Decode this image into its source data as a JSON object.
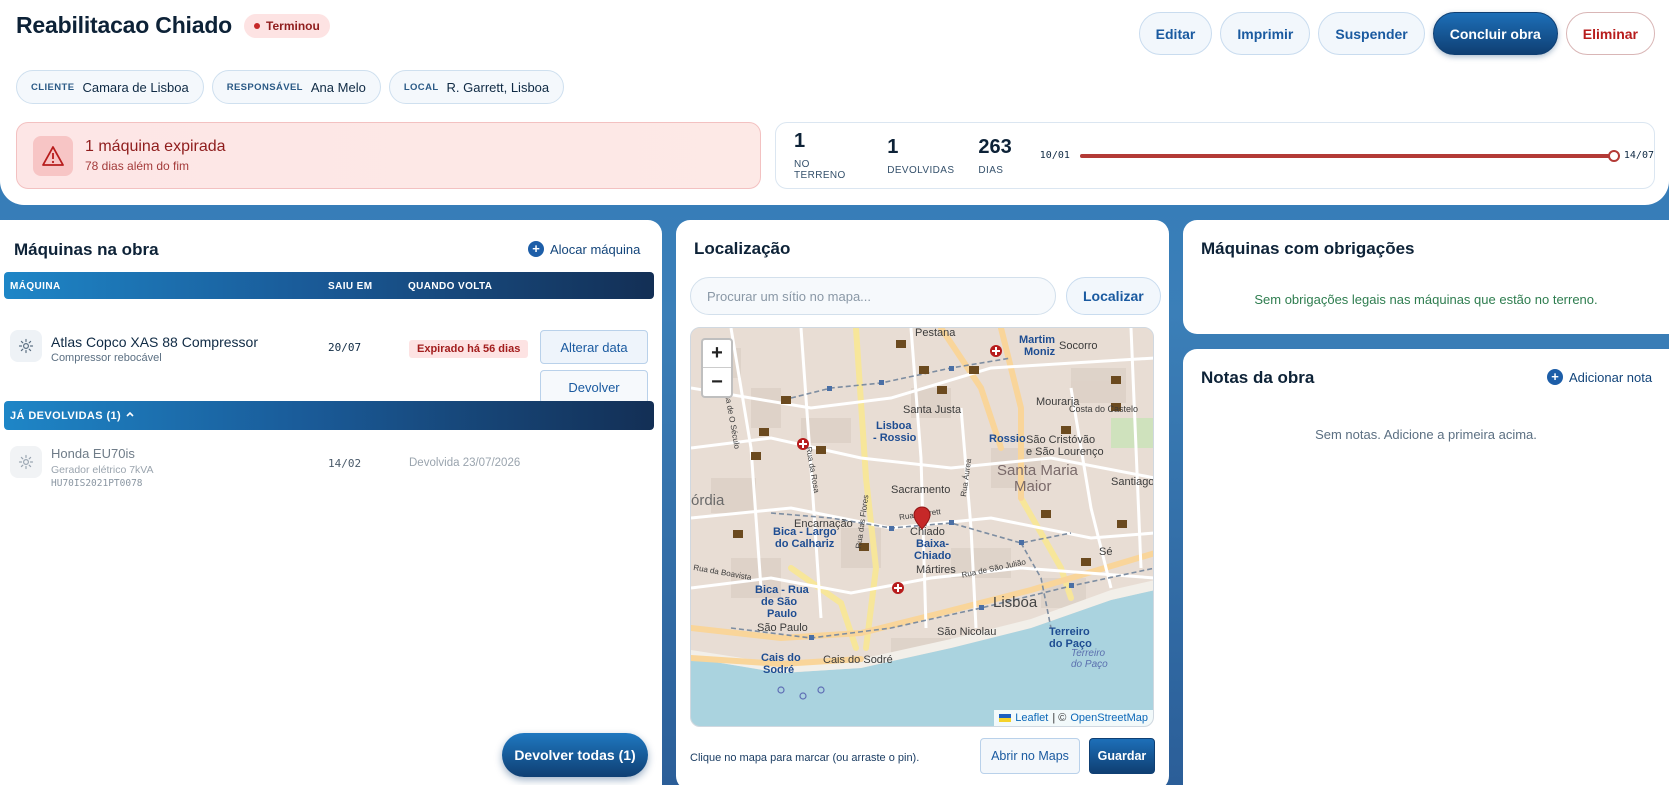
{
  "header": {
    "title": "Reabilitacao Chiado",
    "status": "Terminou",
    "actions": {
      "edit": "Editar",
      "print": "Imprimir",
      "suspend": "Suspender",
      "complete": "Concluir obra",
      "delete": "Eliminar"
    },
    "chips": [
      {
        "key": "CLIENTE",
        "value": "Camara de Lisboa"
      },
      {
        "key": "RESPONSÁVEL",
        "value": "Ana Melo"
      },
      {
        "key": "LOCAL",
        "value": "R. Garrett, Lisboa"
      }
    ]
  },
  "alert": {
    "title": "1 máquina expirada",
    "subtitle": "78 dias além do fim"
  },
  "stats": {
    "items": [
      {
        "value": "1",
        "label": "NO TERRENO"
      },
      {
        "value": "1",
        "label": "DEVOLVIDAS"
      },
      {
        "value": "263",
        "label": "DIAS"
      }
    ],
    "timeline": {
      "start": "10/01",
      "end": "14/07",
      "progress": 1.0
    }
  },
  "machines": {
    "title": "Máquinas na obra",
    "add_label": "Alocar máquina",
    "columns": [
      "MÁQUINA",
      "SAIU EM",
      "QUANDO VOLTA"
    ],
    "active": [
      {
        "name": "Atlas Copco XAS 88 Compressor",
        "type": "Compressor rebocável",
        "left_on": "20/07",
        "status": "Expirado há 56 dias",
        "change_date_label": "Alterar data",
        "return_label": "Devolver"
      }
    ],
    "returned_header": "JÁ DEVOLVIDAS (1)",
    "returned": [
      {
        "name": "Honda EU70is",
        "type": "Gerador elétrico 7kVA",
        "serial": "HU70IS2021PT0078",
        "left_on": "14/02",
        "returned_on": "Devolvida 23/07/2026"
      }
    ],
    "return_all_label": "Devolver todas (1)"
  },
  "location": {
    "title": "Localização",
    "search_placeholder": "Procurar um sítio no mapa...",
    "search_button": "Localizar",
    "hint": "Clique no mapa para marcar (ou arraste o pin).",
    "open_maps": "Abrir no Maps",
    "save": "Guardar",
    "zoom_in": "+",
    "zoom_out": "−",
    "attribution_leaflet": "Leaflet",
    "attribution_sep": "| ©",
    "attribution_osm": "OpenStreetMap",
    "map_labels": {
      "pestana": "Pestana",
      "martim": "Martim",
      "moniz": "Moniz",
      "socorro": "Socorro",
      "mouraria": "Mouraria",
      "costa_castelo": "Costa do Castelo",
      "santa_justa": "Santa Justa",
      "lisboa_rossio_1": "Lisboa",
      "lisboa_rossio_2": "- Rossio",
      "rossio": "Rossio",
      "sao_cristovao": "São Cristóvão",
      "sao_lourenco": "e São Lourenço",
      "santa_maria": "Santa Maria",
      "maior": "Maior",
      "santiago": "Santiago",
      "sacramento": "Sacramento",
      "rua_garrett": "Rua Garrett",
      "chiado": "Chiado",
      "baixa_1": "Baixa-",
      "baixa_2": "Chiado",
      "encarnacao": "Encarnação",
      "ordia": "órdia",
      "bica_largo_1": "Bica - Largo",
      "bica_largo_2": "do Calhariz",
      "martires": "Mártires",
      "se": "Sé",
      "lisboa": "Lisboa",
      "bica_rua_1": "Bica - Rua",
      "bica_rua_2": "de São",
      "bica_rua_3": "Paulo",
      "sao_paulo": "São Paulo",
      "sao_nicolau": "São Nicolau",
      "terreiro_1": "Terreiro",
      "terreiro_2": "do Paço",
      "terreiro_3": "Terreiro",
      "terreiro_4": "do Paço",
      "cais_1": "Cais do",
      "cais_2": "Sodré",
      "cais_sodre": "Cais do Sodré",
      "rua_boavista": "Rua da Boavista",
      "rua_seculo": "Rua de O Século",
      "rua_rosa": "Rua da Rosa",
      "rua_flores": "Rua das Flores",
      "rua_aurea": "Rua Áurea",
      "rua_sao_juliao": "Rua de São Julião"
    }
  },
  "obligations": {
    "title": "Máquinas com obrigações",
    "empty": "Sem obrigações legais nas máquinas que estão no terreno."
  },
  "notes": {
    "title": "Notas da obra",
    "add_label": "Adicionar nota",
    "empty": "Sem notas. Adicione a primeira acima."
  },
  "colors": {
    "accent": "#1d5ea8",
    "danger": "#b33a36",
    "success_text": "#2e7d4f",
    "map_pin": "#c62828"
  }
}
